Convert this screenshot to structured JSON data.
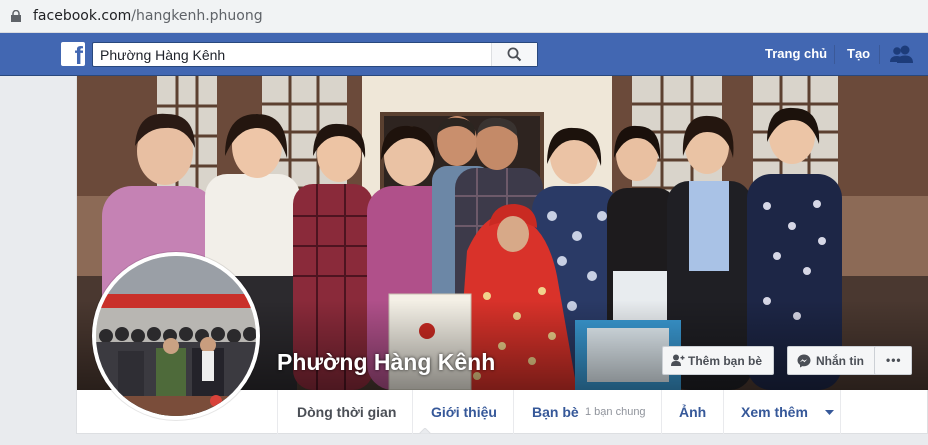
{
  "browser": {
    "url_host": "facebook.com",
    "url_path": "/hangkenh.phuong"
  },
  "topbar": {
    "logo": "f",
    "search_value": "Phường Hàng Kênh",
    "nav": [
      "Trang chủ",
      "Tạo"
    ]
  },
  "page": {
    "name": "Phường Hàng Kênh",
    "add_friend_label": "Thêm bạn bè",
    "message_label": "Nhắn tin",
    "more_label": "•••"
  },
  "tabs": [
    {
      "label": "Dòng thời gian"
    },
    {
      "label": "Giới thiệu"
    },
    {
      "label": "Bạn bè",
      "sub": "1 bạn chung"
    },
    {
      "label": "Ảnh"
    },
    {
      "label": "Xem thêm"
    }
  ],
  "colors": {
    "facebook_blue": "#4267b2",
    "link": "#365899"
  }
}
